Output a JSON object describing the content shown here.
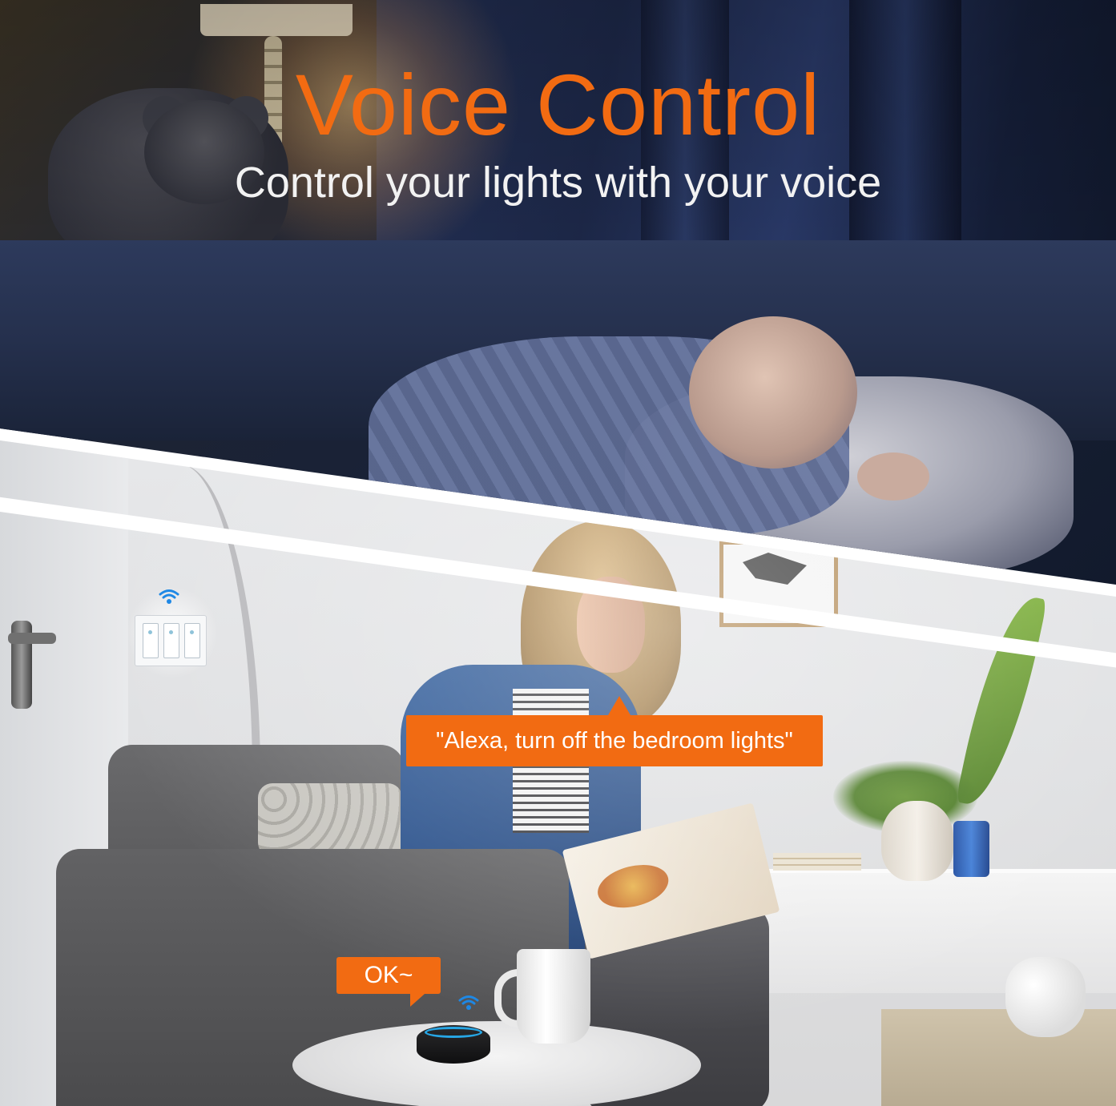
{
  "header": {
    "title": "Voice Control",
    "subtitle": "Control your lights with your voice"
  },
  "speech": {
    "alexa_command": "\"Alexa, turn off the bedroom lights\"",
    "echo_reply": "OK~"
  },
  "colors": {
    "accent": "#f26b12",
    "subtitle_text": "#f2f2f2",
    "wifi_icon": "#1e88e5"
  },
  "icons": {
    "switch_wifi": "wifi-icon",
    "echo_wifi": "wifi-icon"
  }
}
